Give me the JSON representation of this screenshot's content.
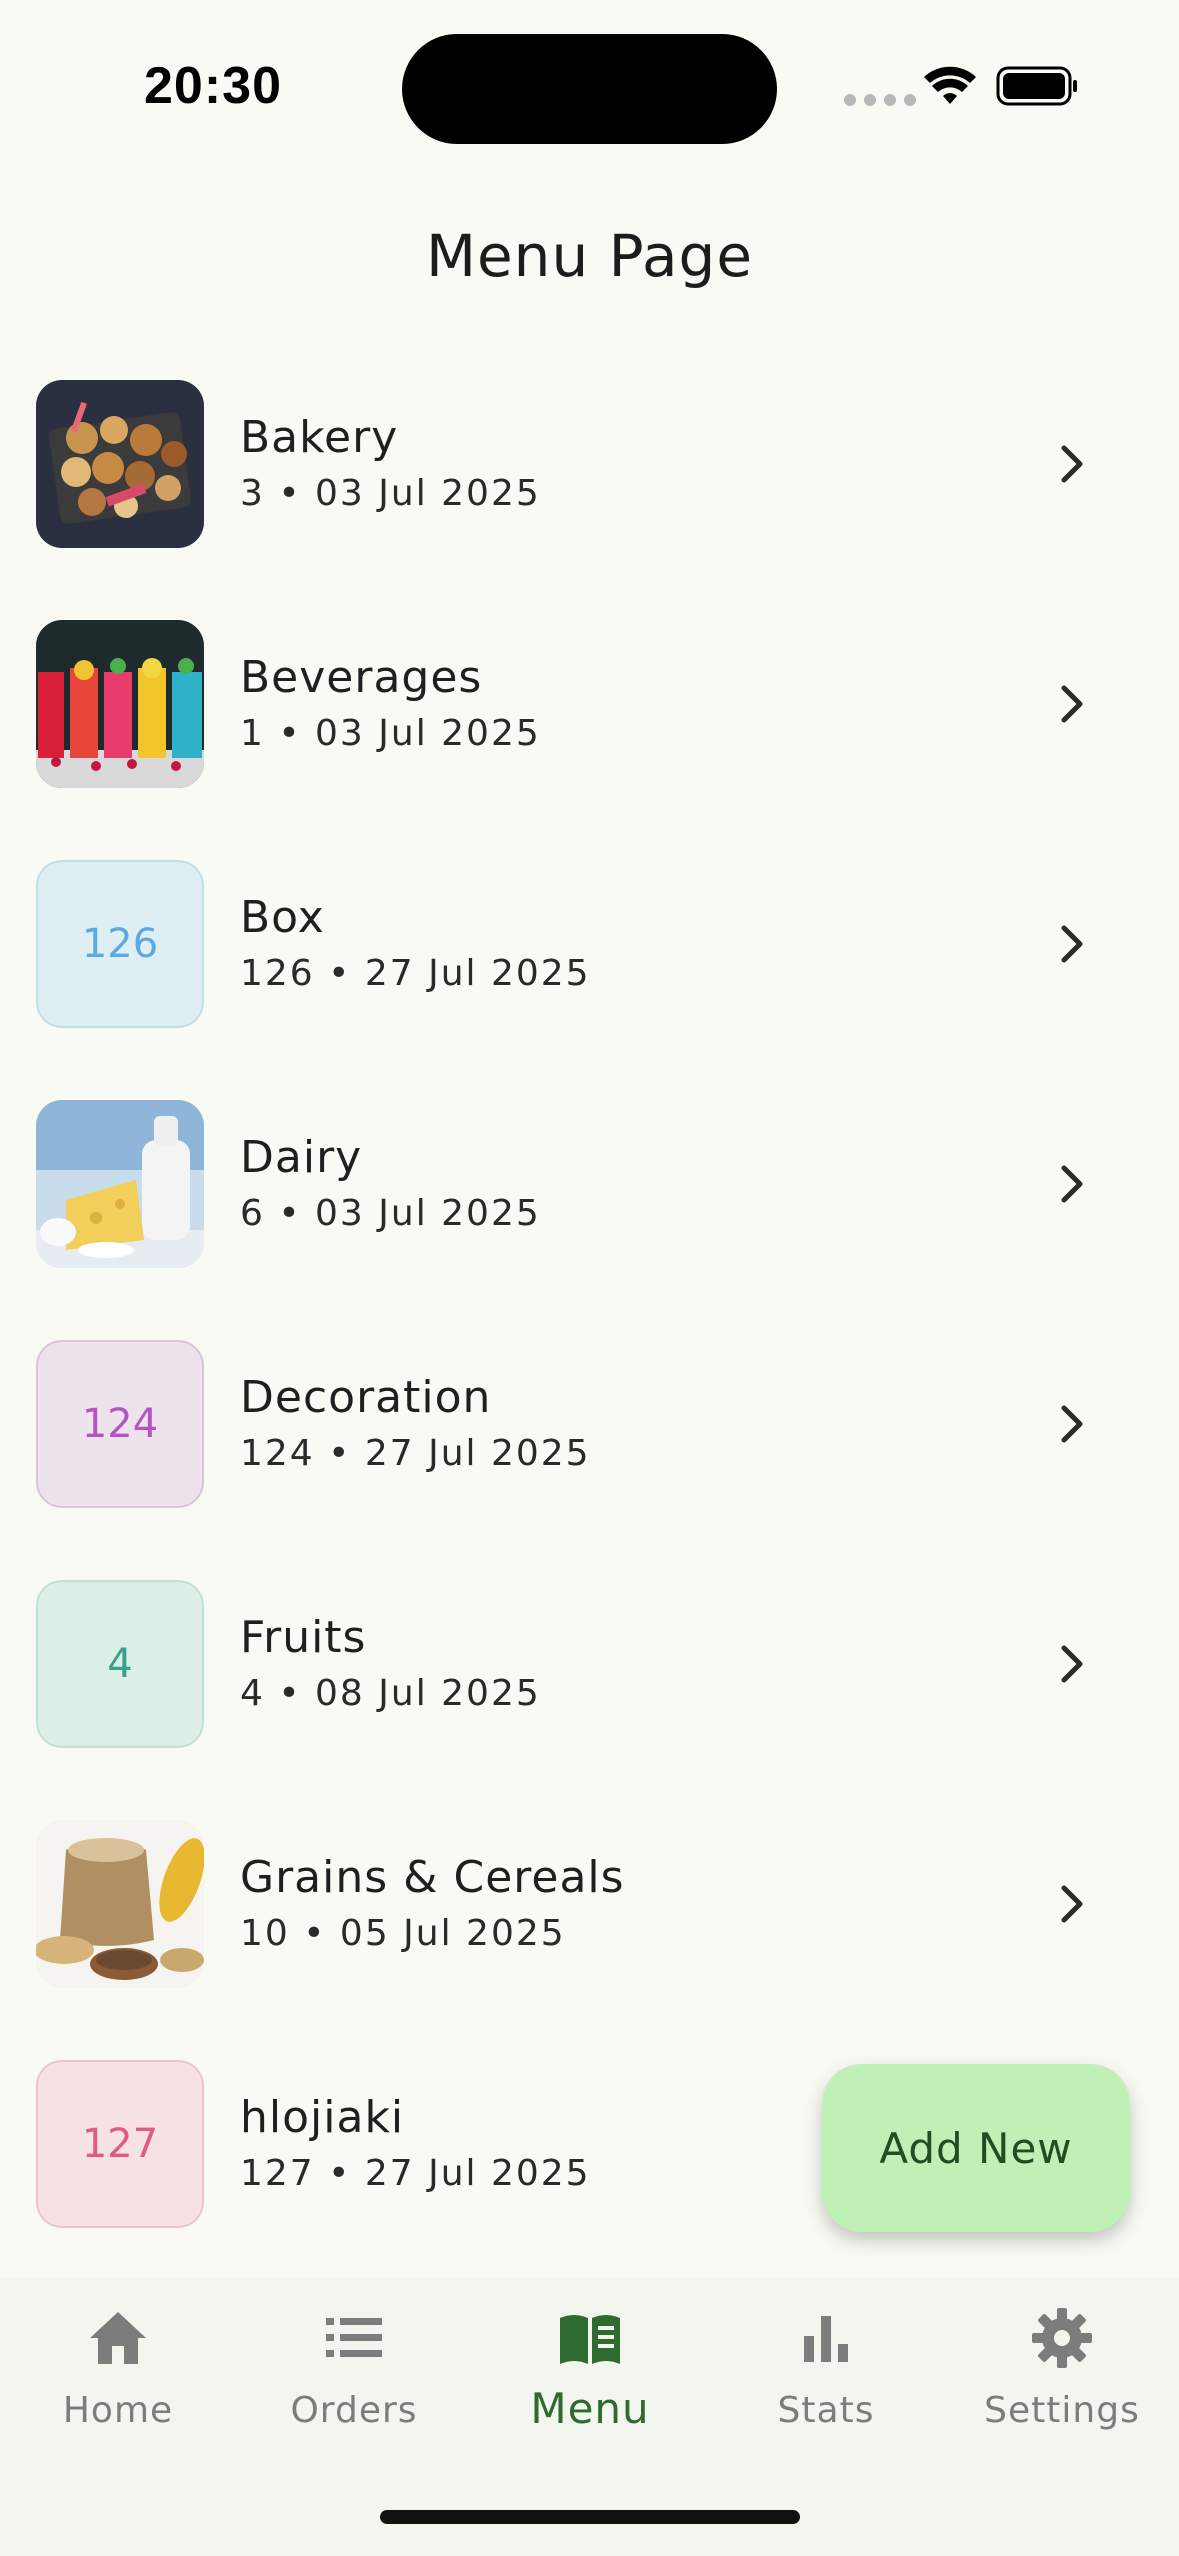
{
  "status_bar": {
    "time": "20:30"
  },
  "page": {
    "title": "Menu Page"
  },
  "items": [
    {
      "name": "Bakery",
      "meta": "3 • 03 Jul 2025",
      "thumb_type": "image",
      "image": "bakery-photo"
    },
    {
      "name": "Beverages",
      "meta": "1 • 03 Jul 2025",
      "thumb_type": "image",
      "image": "beverages-photo"
    },
    {
      "name": "Box",
      "meta": "126 • 27 Jul 2025",
      "thumb_type": "count",
      "count": "126",
      "color": "#5aa9e0",
      "bg": "#ddeff3",
      "border": "#bfe0ea"
    },
    {
      "name": "Dairy",
      "meta": "6 • 03 Jul 2025",
      "thumb_type": "image",
      "image": "dairy-photo"
    },
    {
      "name": "Decoration",
      "meta": "124 • 27 Jul 2025",
      "thumb_type": "count",
      "count": "124",
      "color": "#b454c4",
      "bg": "#ede3ec",
      "border": "#dbc4de"
    },
    {
      "name": "Fruits",
      "meta": "4 • 08 Jul 2025",
      "thumb_type": "count",
      "count": "4",
      "color": "#3aa08c",
      "bg": "#dbefe5",
      "border": "#bfe2d4"
    },
    {
      "name": "Grains & Cereals",
      "meta": "10 • 05 Jul 2025",
      "thumb_type": "image",
      "image": "grains-photo"
    },
    {
      "name": "hlojiaki",
      "meta": "127 • 27 Jul 2025",
      "thumb_type": "count",
      "count": "127",
      "color": "#e05a84",
      "bg": "#f6e1e3",
      "border": "#ecc4cb"
    }
  ],
  "fab": {
    "label": "Add New"
  },
  "nav": {
    "home": "Home",
    "orders": "Orders",
    "menu": "Menu",
    "stats": "Stats",
    "settings": "Settings",
    "active": "Menu",
    "active_color": "#2f6b2f",
    "inactive_color": "#7c7c7c"
  }
}
